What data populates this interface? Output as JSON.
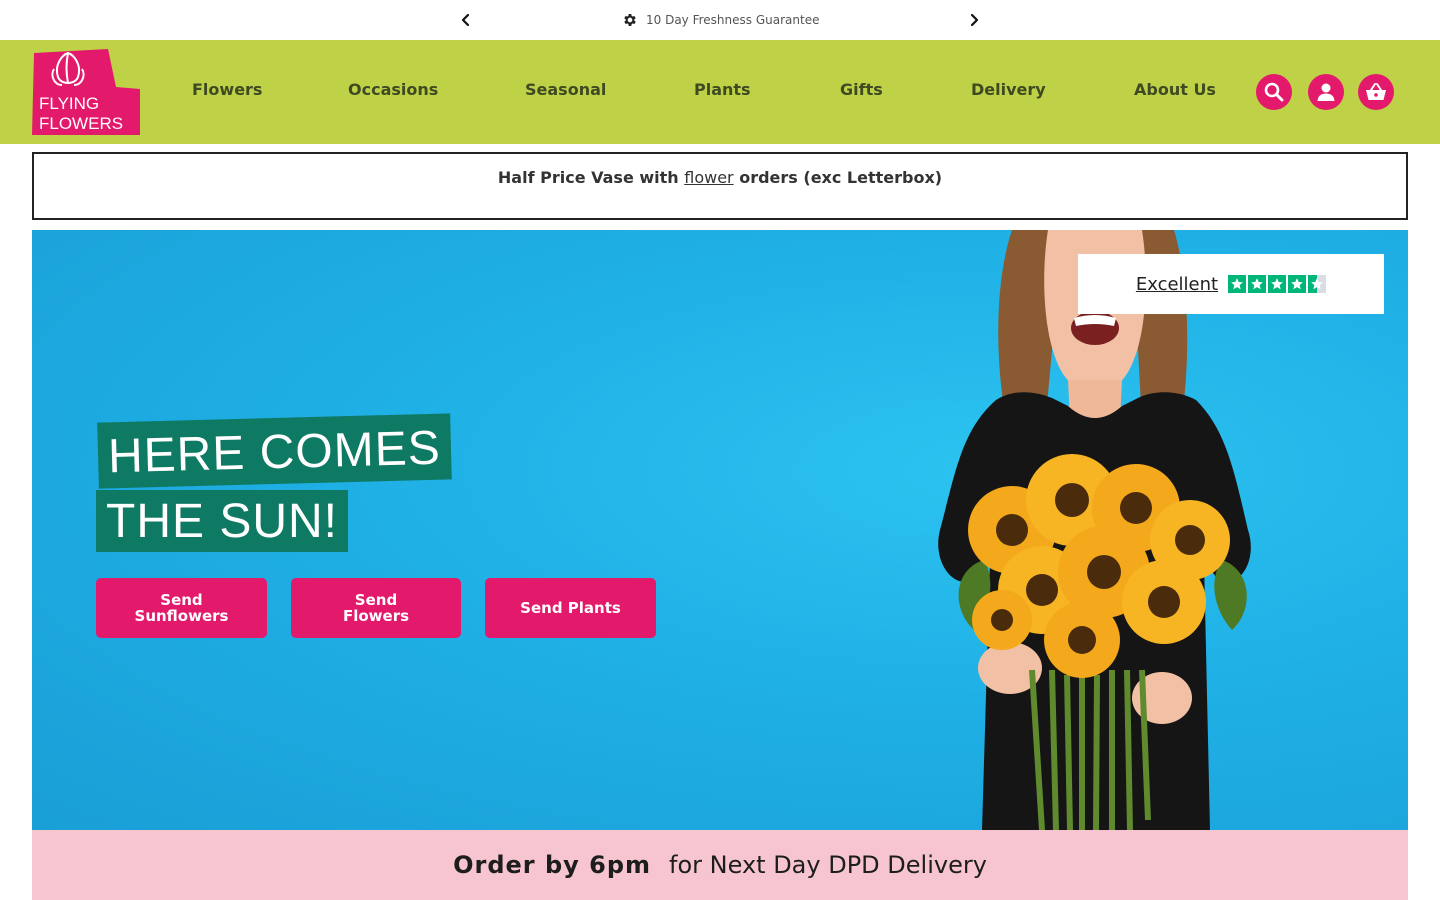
{
  "topbar": {
    "message": "10 Day Freshness Guarantee",
    "message_icon": "gear-icon",
    "prev_icon": "chevron-left-icon",
    "next_icon": "chevron-right-icon"
  },
  "header": {
    "logo_line1": "FLYING",
    "logo_line2": "FLOWERS",
    "nav": [
      {
        "label": "Flowers"
      },
      {
        "label": "Occasions"
      },
      {
        "label": "Seasonal"
      },
      {
        "label": "Plants"
      },
      {
        "label": "Gifts"
      },
      {
        "label": "Delivery"
      },
      {
        "label": "About Us"
      }
    ],
    "icons": {
      "search": "search-icon",
      "account": "user-icon",
      "basket": "basket-icon"
    }
  },
  "promo": {
    "before": "Half Price Vase with",
    "link": "flower",
    "after": "orders (exc Letterbox)"
  },
  "hero": {
    "trust_label": "Excellent",
    "trust_rating": 4.5,
    "headline_line1": "HERE COMES",
    "headline_line2": "THE SUN!",
    "buttons": [
      {
        "line1": "Send",
        "line2": "Sunflowers"
      },
      {
        "line1": "Send",
        "line2": "Flowers"
      },
      {
        "label": "Send Plants"
      }
    ]
  },
  "delivery": {
    "strong": "Order by 6pm",
    "rest": "for Next Day DPD Delivery"
  },
  "colors": {
    "header_green": "#bfd247",
    "brand_pink": "#e3196b",
    "hero_blue": "#1fb0e6",
    "headline_green": "#0f7a63",
    "delivery_pink": "#f6c5cf",
    "trust_green": "#00b67a"
  }
}
